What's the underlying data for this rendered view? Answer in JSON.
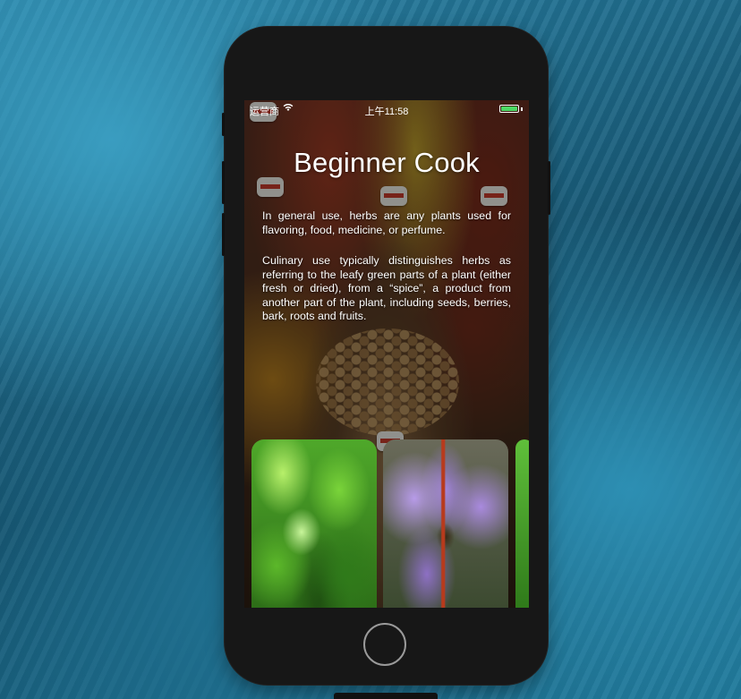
{
  "status_bar": {
    "carrier": "运营商",
    "wifi_icon": "wifi-icon",
    "time": "上午11:58",
    "battery_icon": "battery-icon",
    "battery_color": "#4cd964"
  },
  "header": {
    "title": "Beginner Cook"
  },
  "description": {
    "paragraph_1": "In general use, herbs are any plants used for flavoring, food, medicine, or perfume.",
    "paragraph_2": "Culinary use typically distinguishes herbs as referring to the leafy green parts of a plant (either fresh or dried), from a “spice”, a product from another part of the plant, including seeds, berries, bark, roots and fruits."
  },
  "herb_cards": [
    {
      "image": "basil-image"
    },
    {
      "image": "saffron-flower-image"
    },
    {
      "image": "herb-image-partial"
    }
  ]
}
